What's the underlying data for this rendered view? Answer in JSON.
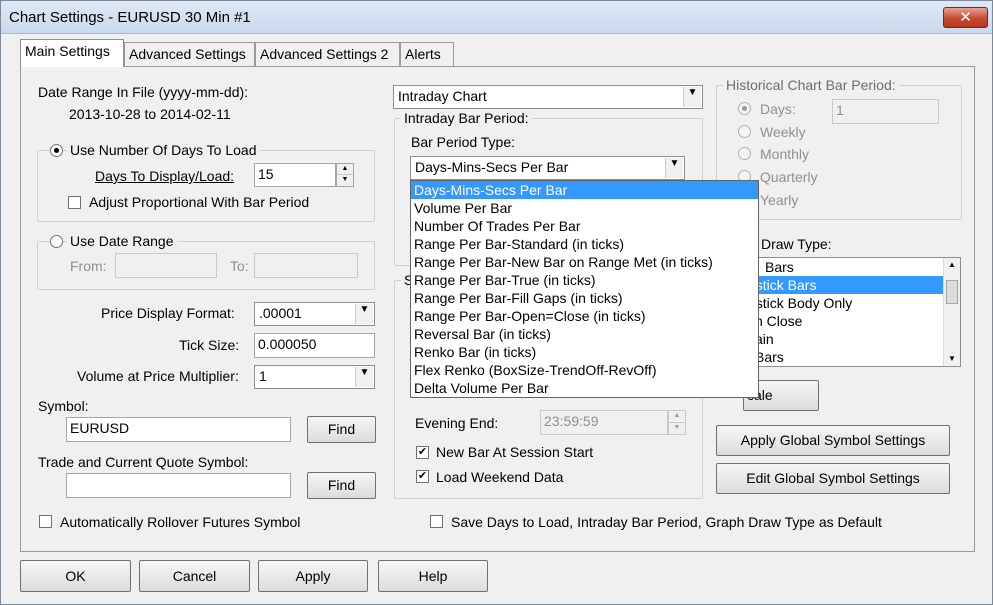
{
  "window": {
    "title": "Chart Settings - EURUSD  30 Min   #1",
    "close_label": "✕"
  },
  "tabs": [
    "Main Settings",
    "Advanced Settings",
    "Advanced Settings 2",
    "Alerts"
  ],
  "date_range": {
    "label": "Date Range In File (yyyy-mm-dd):",
    "value": "2013-10-28 to 2014-02-11"
  },
  "days_group": {
    "radio_label": "Use Number Of Days To Load",
    "days_label": "Days To Display/Load:",
    "days_value": "15",
    "adjust_label": "Adjust Proportional With Bar Period"
  },
  "date_group": {
    "radio_label": "Use Date Range",
    "from_label": "From:",
    "to_label": "To:"
  },
  "price_format": {
    "label": "Price Display Format:",
    "value": ".00001"
  },
  "tick_size": {
    "label": "Tick Size:",
    "value": "0.000050"
  },
  "volume_multiplier": {
    "label": "Volume at Price Multiplier:",
    "value": "1"
  },
  "symbol": {
    "label": "Symbol:",
    "value": "EURUSD",
    "find_label": "Find"
  },
  "trade_symbol": {
    "label": "Trade and Current Quote Symbol:",
    "value": "",
    "find_label": "Find"
  },
  "auto_rollover_label": "Automatically Rollover Futures Symbol",
  "chart_type": {
    "value": "Intraday Chart"
  },
  "intraday": {
    "group_title": "Intraday Bar Period:",
    "bar_type_label": "Bar Period Type:",
    "bar_type_value": "Days-Mins-Secs Per Bar",
    "options": [
      "Days-Mins-Secs Per Bar",
      "Volume Per Bar",
      "Number Of Trades Per Bar",
      "Range Per Bar-Standard (in ticks)",
      "Range Per Bar-New Bar on Range Met (in ticks)",
      "Range Per Bar-True (in ticks)",
      "Range Per Bar-Fill Gaps (in ticks)",
      "Range Per Bar-Open=Close (in ticks)",
      "Reversal Bar (in ticks)",
      "Renko Bar (in ticks)",
      "Flex Renko (BoxSize-TrendOff-RevOff)",
      "Delta Volume Per Bar"
    ]
  },
  "session": {
    "group_title_fragment": "S",
    "evening_end_label": "Evening End:",
    "evening_end_value": "23:59:59",
    "new_bar_label": "New Bar At Session Start",
    "weekend_label": "Load Weekend Data"
  },
  "historical": {
    "group_title": "Historical Chart Bar Period:",
    "days_label": "Days:",
    "days_value": "1",
    "weekly_label": "Weekly",
    "monthly_label": "Monthly",
    "quarterly_label": "Quarterly",
    "yearly_label": "Yearly"
  },
  "draw_type": {
    "label_fragment": "Draw Type:",
    "items": [
      "Bars",
      "estick Bars",
      "estick Body Only",
      "n Close",
      "ain",
      "Bars"
    ],
    "scale_label": "cale"
  },
  "global_buttons": {
    "apply": "Apply Global Symbol Settings",
    "edit": "Edit Global Symbol Settings"
  },
  "save_default_label": "Save Days to Load, Intraday Bar Period, Graph Draw Type as Default",
  "bottom_buttons": {
    "ok": "OK",
    "cancel": "Cancel",
    "apply": "Apply",
    "help": "Help"
  }
}
